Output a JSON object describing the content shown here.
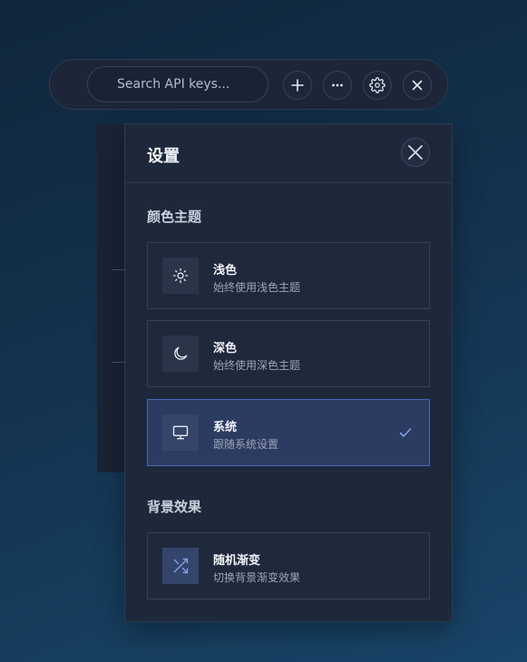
{
  "toolbar": {
    "search": {
      "placeholder": "Search API keys..."
    },
    "buttons": [
      {
        "name": "add",
        "icon": "plus-icon"
      },
      {
        "name": "more",
        "icon": "more-horizontal-icon"
      },
      {
        "name": "settings",
        "icon": "gear-icon"
      },
      {
        "name": "close",
        "icon": "close-icon"
      }
    ]
  },
  "settings": {
    "title": "设置",
    "close_icon": "close-icon",
    "theme_section": {
      "title": "颜色主题",
      "options": [
        {
          "title": "浅色",
          "desc": "始终使用浅色主题",
          "icon": "sun-icon",
          "selected": false
        },
        {
          "title": "深色",
          "desc": "始终使用深色主题",
          "icon": "moon-icon",
          "selected": false
        },
        {
          "title": "系统",
          "desc": "跟随系统设置",
          "icon": "monitor-icon",
          "selected": true
        }
      ]
    },
    "background_section": {
      "title": "背景效果",
      "options": [
        {
          "title": "随机渐变",
          "desc": "切换背景渐变效果",
          "icon": "shuffle-icon"
        }
      ]
    }
  },
  "colors": {
    "accent": "#4a66b8",
    "check": "#7fa0e8",
    "panel": "#1e283b"
  }
}
